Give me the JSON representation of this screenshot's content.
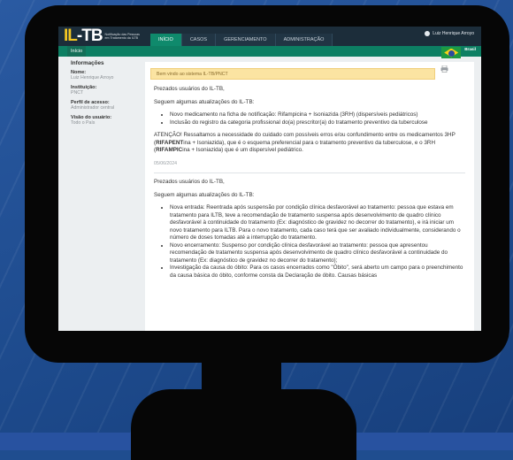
{
  "app": {
    "logo_prefix": "IL",
    "logo_suffix": "-TB",
    "logo_subtitle": "Notificação das Pessoas em Tratamento da ILTB",
    "tabs": [
      "INÍCIO",
      "CASOS",
      "GERENCIAMENTO",
      "ADMINISTRAÇÃO"
    ],
    "active_tab": 0,
    "user_name": "Luiz Henrique Arroyo",
    "breadcrumb": "Início",
    "country": "Brasil"
  },
  "sidebar": {
    "title": "Informações",
    "fields": [
      {
        "label": "Nome:",
        "value": "Luiz Henrique Arroyo"
      },
      {
        "label": "Instituição:",
        "value": "PNCT"
      },
      {
        "label": "Perfil de acesso:",
        "value": "Administrador central"
      },
      {
        "label": "Visão do usuário:",
        "value": "Todo o País"
      }
    ]
  },
  "content": {
    "welcome": "Bem vindo ao sistema IL-TB/PNCT",
    "message1": {
      "greeting": "Prezados usuários do IL-TB,",
      "intro": "Seguem algumas atualizações do IL-TB:",
      "bullets": [
        "Novo medicamento na ficha de notificação: Rifampicina + Isoniazida (3RH) (dispersíveis pediátricos)",
        "Inclusão do registro da categoria profissional do(a) prescritor(a) do tratamento preventivo da tuberculose"
      ],
      "attention_pre": "ATENÇÃO! Ressaltamos a necessidade do cuidado com possíveis erros e/ou confundimento entre os medicamentos 3HP (",
      "attention_b1": "RIFAPENT",
      "attention_mid1": "ina + Isoniazida), que é o esquema preferencial para o tratamento preventivo da tuberculose, e o 3RH (",
      "attention_b2": "RIFAMPIC",
      "attention_post": "ina + Isoniazida) que é um dispersível pediátrico.",
      "date": "05/06/2024"
    },
    "message2": {
      "greeting": "Prezados usuários do IL-TB,",
      "intro": "Seguem algumas atualizações do IL-TB:",
      "bullets": [
        "Nova entrada: Reentrada após suspensão por condição clínica desfavorável ao tratamento: pessoa que estava em tratamento para ILTB, teve a recomendação de tratamento suspensa após desenvolvimento de quadro clínico desfavorável à continuidade do tratamento (Ex: diagnóstico de gravidez no decorrer do tratamento), e irá iniciar um novo tratamento para ILTB. Para o novo tratamento, cada caso terá que ser avaliado individualmente, considerando o número de doses tomadas até a interrupção do tratamento.",
        "Novo encerramento: Suspenso por condição clínica desfavorável ao tratamento: pessoa que apresentou recomendação de tratamento suspensa após desenvolvimento de quadro clínico desfavorável a continuidade do tratamento (Ex: diagnóstico de gravidez no decorrer do tratamento);",
        "Investigação da causa do óbito: Para os casos encerrados como \"Óbito\", será aberto um campo para o preenchimento da causa básica do óbito, conforme consta da Declaração de óbito. Causas básicas"
      ]
    }
  },
  "colors": {
    "header": "#1c2d3a",
    "accent": "#0f8a6c",
    "welcome_bg": "#fbe4a2",
    "background": "#1f4d8f"
  }
}
